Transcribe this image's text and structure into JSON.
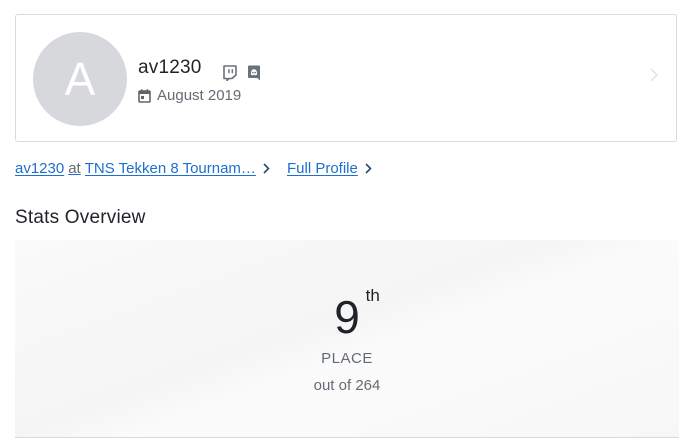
{
  "profile": {
    "avatar_initial": "A",
    "username": "av1230",
    "social_icons": [
      "twitch-icon",
      "discord-icon"
    ],
    "joined": "August 2019"
  },
  "links": {
    "player": "av1230",
    "at": "at",
    "event": "TNS Tekken 8 Tournam…",
    "full_profile": "Full Profile"
  },
  "stats": {
    "title": "Stats Overview",
    "place_number": "9",
    "place_suffix": "th",
    "place_label": "PLACE",
    "out_of": "out of 264"
  },
  "colors": {
    "link": "#1e6fd0",
    "muted": "#636b74",
    "avatar_bg": "#d6d8dc"
  }
}
